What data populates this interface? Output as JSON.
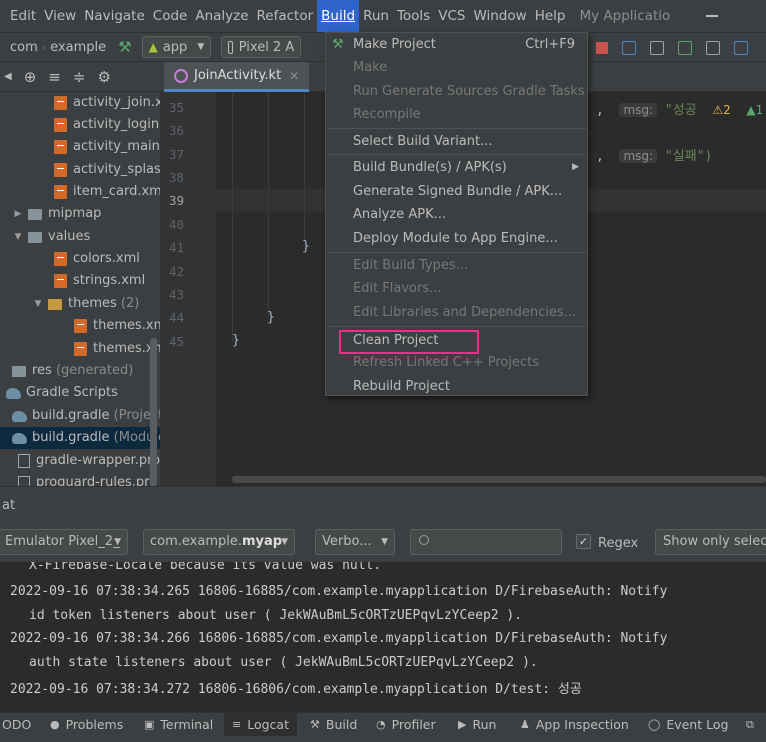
{
  "menubar": {
    "items": [
      "Edit",
      "View",
      "Navigate",
      "Code",
      "Analyze",
      "Refactor",
      "Build",
      "Run",
      "Tools",
      "VCS",
      "Window",
      "Help"
    ],
    "active": "Build",
    "app_title": "My Applicatio"
  },
  "navbar": {
    "crumbs": [
      "com",
      "example"
    ],
    "config": "app",
    "device": "Pixel 2 A"
  },
  "editor": {
    "tab": "JoinActivity.kt",
    "lines": [
      "35",
      "36",
      "37",
      "38",
      "39",
      "40",
      "41",
      "42",
      "43",
      "44",
      "45"
    ],
    "current_line": "39",
    "hint_msg_1": "msg:",
    "str_1": "\"성공",
    "warnings": "2",
    "oks": "1",
    "hint_msg_2": "msg:",
    "str_2": "\"실패\")",
    "punct_1": ",",
    "punct_2": ",",
    "brace_41": "}",
    "brace_44": "}",
    "brace_45": "}"
  },
  "project_tree": [
    {
      "label": "activity_join.xml",
      "icon": "xml-icon"
    },
    {
      "label": "activity_login.xml",
      "icon": "xml-icon"
    },
    {
      "label": "activity_main.xml",
      "icon": "xml-icon"
    },
    {
      "label": "activity_splash",
      "icon": "xml-icon"
    },
    {
      "label": "item_card.xml",
      "icon": "xml-icon"
    },
    {
      "label": "mipmap",
      "icon": "folder-icon"
    },
    {
      "label": "values",
      "icon": "folder-icon"
    },
    {
      "label": "colors.xml",
      "icon": "xml-icon"
    },
    {
      "label": "strings.xml",
      "icon": "xml-icon"
    },
    {
      "label": "themes",
      "extra": "(2)",
      "icon": "folder-icon"
    },
    {
      "label": "themes.xml",
      "icon": "xml-icon"
    },
    {
      "label": "themes.xml",
      "icon": "xml-icon"
    },
    {
      "label": "res",
      "extra": "(generated)",
      "icon": "folder-icon"
    },
    {
      "label": "Gradle Scripts",
      "icon": "gradle-icon"
    },
    {
      "label": "build.gradle",
      "extra": "(Project:",
      "icon": "gradle-icon"
    },
    {
      "label": "build.gradle",
      "extra": "(Module",
      "icon": "gradle-icon"
    },
    {
      "label": "gradle-wrapper.prop",
      "icon": "file-icon"
    },
    {
      "label": "proguard-rules.pro",
      "extra": "(",
      "icon": "file-icon"
    }
  ],
  "build_menu": {
    "items": [
      {
        "label": "Make Project",
        "shortcut": "Ctrl+F9",
        "enabled": true
      },
      {
        "label": "Make",
        "enabled": false
      },
      {
        "label": "Run Generate Sources Gradle Tasks",
        "enabled": false
      },
      {
        "label": "Recompile",
        "enabled": false
      },
      {
        "label": "Select Build Variant...",
        "enabled": true
      },
      {
        "label": "Build Bundle(s) / APK(s)",
        "enabled": true,
        "submenu": true
      },
      {
        "label": "Generate Signed Bundle / APK...",
        "enabled": true
      },
      {
        "label": "Analyze APK...",
        "enabled": true
      },
      {
        "label": "Deploy Module to App Engine...",
        "enabled": true
      },
      {
        "label": "Edit Build Types...",
        "enabled": false
      },
      {
        "label": "Edit Flavors...",
        "enabled": false
      },
      {
        "label": "Edit Libraries and Dependencies...",
        "enabled": false
      },
      {
        "label": "Clean Project",
        "enabled": true
      },
      {
        "label": "Refresh Linked C++ Projects",
        "enabled": false
      },
      {
        "label": "Rebuild Project",
        "enabled": true
      }
    ]
  },
  "logcat": {
    "title": "at",
    "device": "Emulator Pixel_2_",
    "package_prefix": "com.example.",
    "package_bold": "myap",
    "level": "Verbo...",
    "search_placeholder": "",
    "regex_checked": "✓",
    "regex_label": "Regex",
    "show_only": "Show only select",
    "lines": [
      {
        "text": "X-Firebase-Locale because its value was null.",
        "indent": true
      },
      {
        "text": "2022-09-16 07:38:34.265 16806-16885/com.example.myapplication D/FirebaseAuth: Notify",
        "indent": false
      },
      {
        "text": "id token listeners about user ( JekWAuBmL5cORTzUEPqvLzYCeep2 ).",
        "indent": true
      },
      {
        "text": "2022-09-16 07:38:34.266 16806-16885/com.example.myapplication D/FirebaseAuth: Notify",
        "indent": false
      },
      {
        "text": "auth state listeners about user ( JekWAuBmL5cORTzUEPqvLzYCeep2 ).",
        "indent": true
      },
      {
        "text": "2022-09-16 07:38:34.272 16806-16806/com.example.myapplication D/test: 성공",
        "indent": false
      }
    ]
  },
  "tool_windows": [
    {
      "label": "ODO",
      "icon": ""
    },
    {
      "label": "Problems",
      "icon": "problems-icon"
    },
    {
      "label": "Terminal",
      "icon": "terminal-icon"
    },
    {
      "label": "Logcat",
      "icon": "logcat-icon",
      "active": true
    },
    {
      "label": "Build",
      "icon": "hammer-icon"
    },
    {
      "label": "Profiler",
      "icon": "profiler-icon"
    },
    {
      "label": "Run",
      "icon": "play-icon"
    },
    {
      "label": "App Inspection",
      "icon": "inspection-icon"
    },
    {
      "label": "Event Log",
      "icon": "event-log-icon"
    }
  ]
}
